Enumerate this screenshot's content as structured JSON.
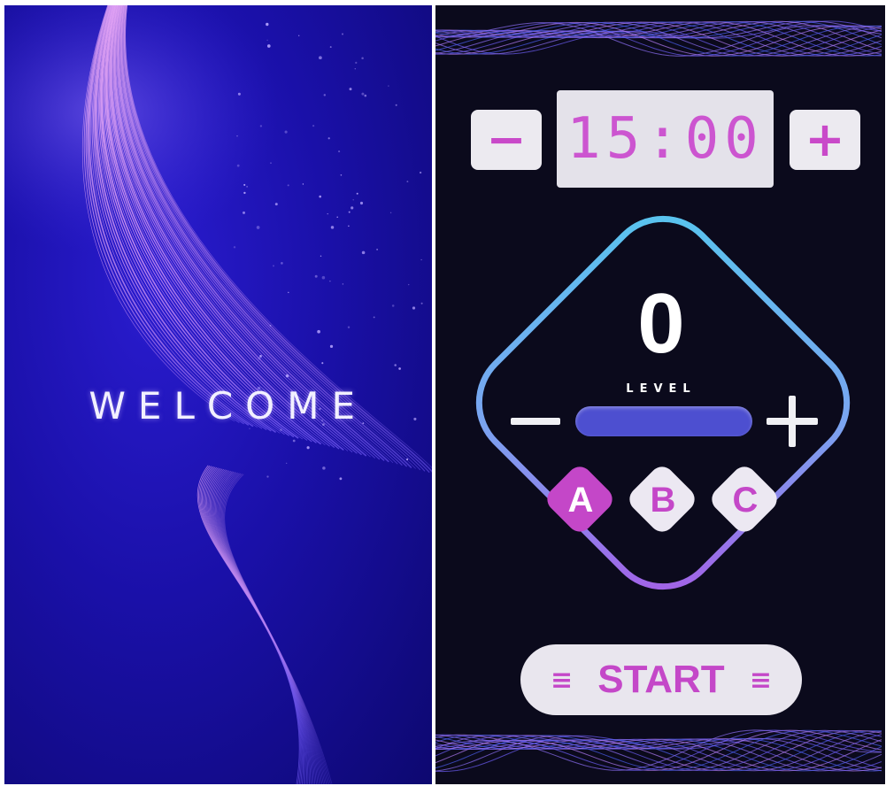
{
  "welcome_screen": {
    "welcome_text": "WELCOME"
  },
  "control_screen": {
    "timer": {
      "value": "15:00",
      "decrease_label": "−",
      "increase_label": "+"
    },
    "level": {
      "value": "0",
      "label": "LEVEL",
      "level_fraction": 0
    },
    "modes": [
      {
        "label": "A",
        "active": true
      },
      {
        "label": "B",
        "active": false
      },
      {
        "label": "C",
        "active": false
      }
    ],
    "start": {
      "label": "START",
      "left_icon": "≡",
      "right_icon": "≡"
    }
  },
  "colors": {
    "accent_magenta": "#c447c8",
    "button_light": "#eceaf0",
    "level_bar": "#4d4fd0",
    "frame_cyan": "#56c6ee",
    "frame_purple": "#a65ce6",
    "welcome_bg": "#1a10a8",
    "control_bg": "#0b0a1c"
  }
}
